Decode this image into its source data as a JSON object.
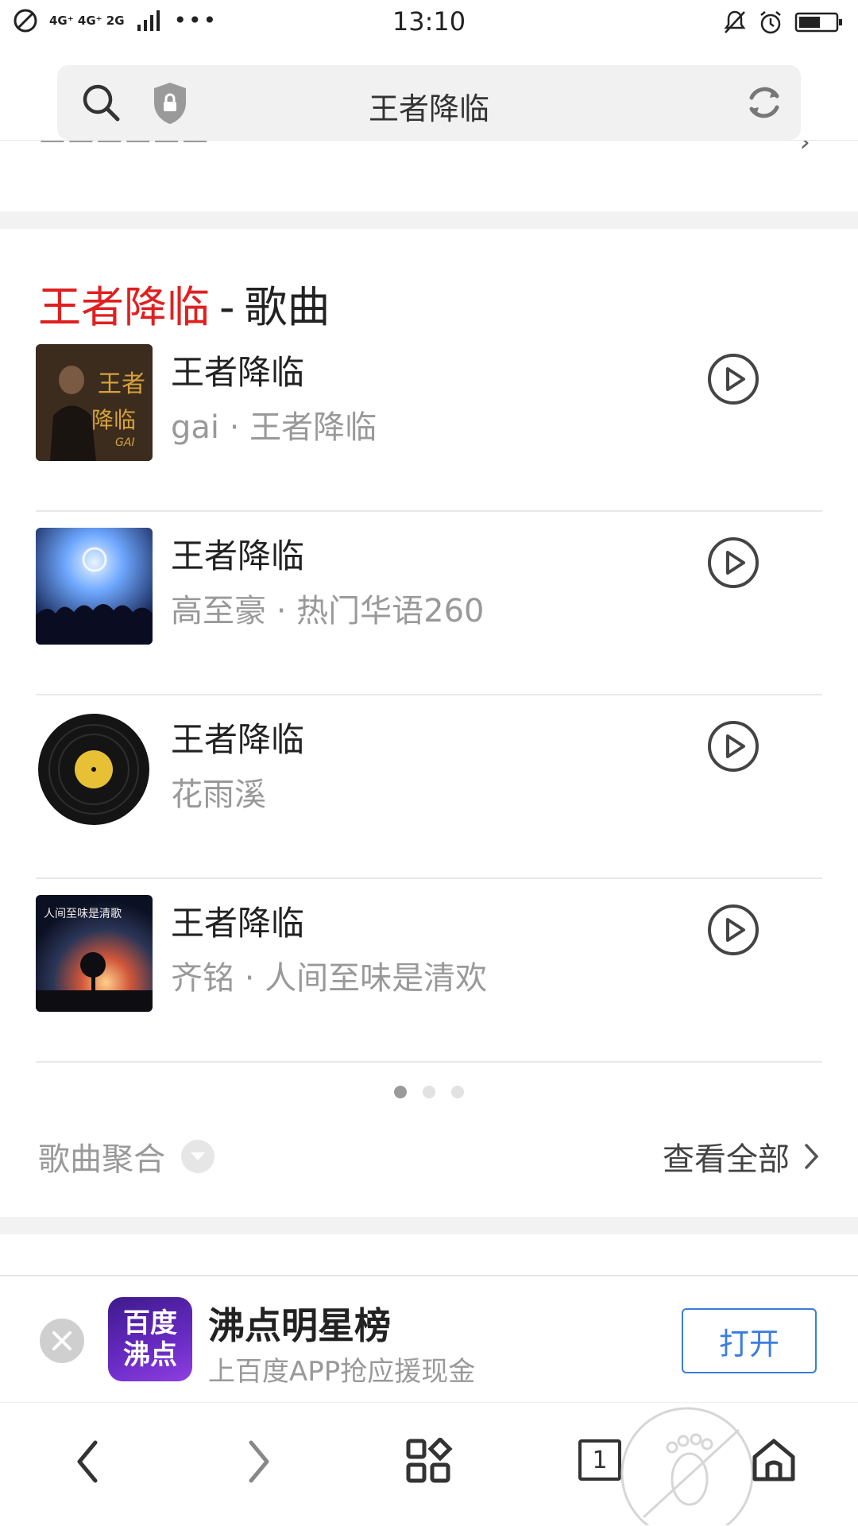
{
  "status_bar": {
    "network": "4G⁺ 4G⁺ 2G",
    "more": "•••",
    "time": "13:10"
  },
  "search": {
    "query": "王者降临"
  },
  "card": {
    "keyword": "王者降临",
    "separator": "-",
    "category": "歌曲"
  },
  "songs": [
    {
      "title": "王者降临",
      "subtitle": "gai · 王者降临"
    },
    {
      "title": "王者降临",
      "subtitle": "高至豪 · 热门华语260"
    },
    {
      "title": "王者降临",
      "subtitle": "花雨溪"
    },
    {
      "title": "王者降临",
      "subtitle": "齐铭 · 人间至味是清欢"
    }
  ],
  "cover_text": {
    "song1": "王者降临",
    "song1_small": "GAI",
    "song4": "人间至味是清歌"
  },
  "footer": {
    "aggregate_label": "歌曲聚合",
    "view_all_label": "查看全部"
  },
  "banner": {
    "logo_line1": "百度",
    "logo_line2": "沸点",
    "title": "沸点明星榜",
    "subtitle": "上百度APP抢应援现金",
    "open_label": "打开"
  },
  "bottom_nav": {
    "tab_count": "1"
  },
  "colors": {
    "keyword_red": "#e02020",
    "link_blue": "#3b7ddd"
  }
}
